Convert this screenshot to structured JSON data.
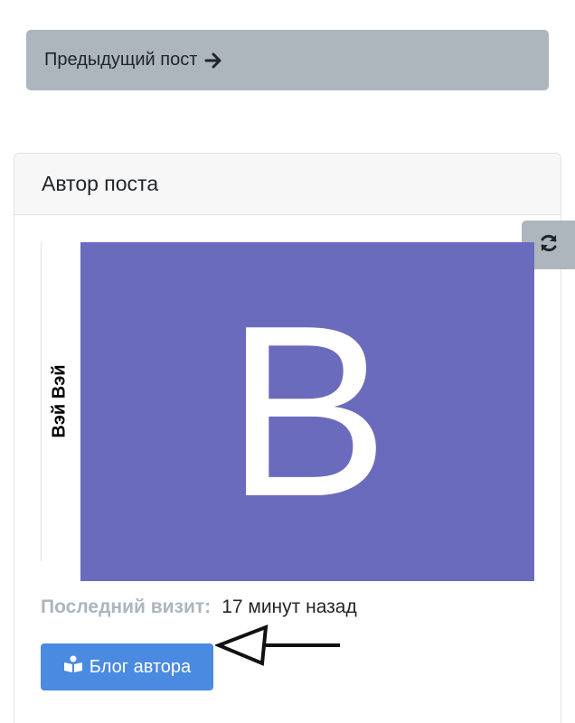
{
  "navigation": {
    "prev_post_label": "Предыдущий пост"
  },
  "author_card": {
    "header_title": "Автор поста",
    "author_name": "Вэй Вэй",
    "avatar_letter": "B",
    "avatar_color": "#6b6bbd",
    "last_visit_label": "Последний визит:",
    "last_visit_value": "17 минут назад",
    "blog_button_label": "Блог автора"
  },
  "icons": {
    "prev_post": "arrow-right-icon",
    "refresh": "refresh-icon",
    "blog": "reader-book-icon",
    "annotation": "annotation-arrow-icon"
  },
  "colors": {
    "secondary_button": "#adb5bd",
    "primary_button": "#4a8ae0",
    "muted_text": "#adb5bd"
  }
}
